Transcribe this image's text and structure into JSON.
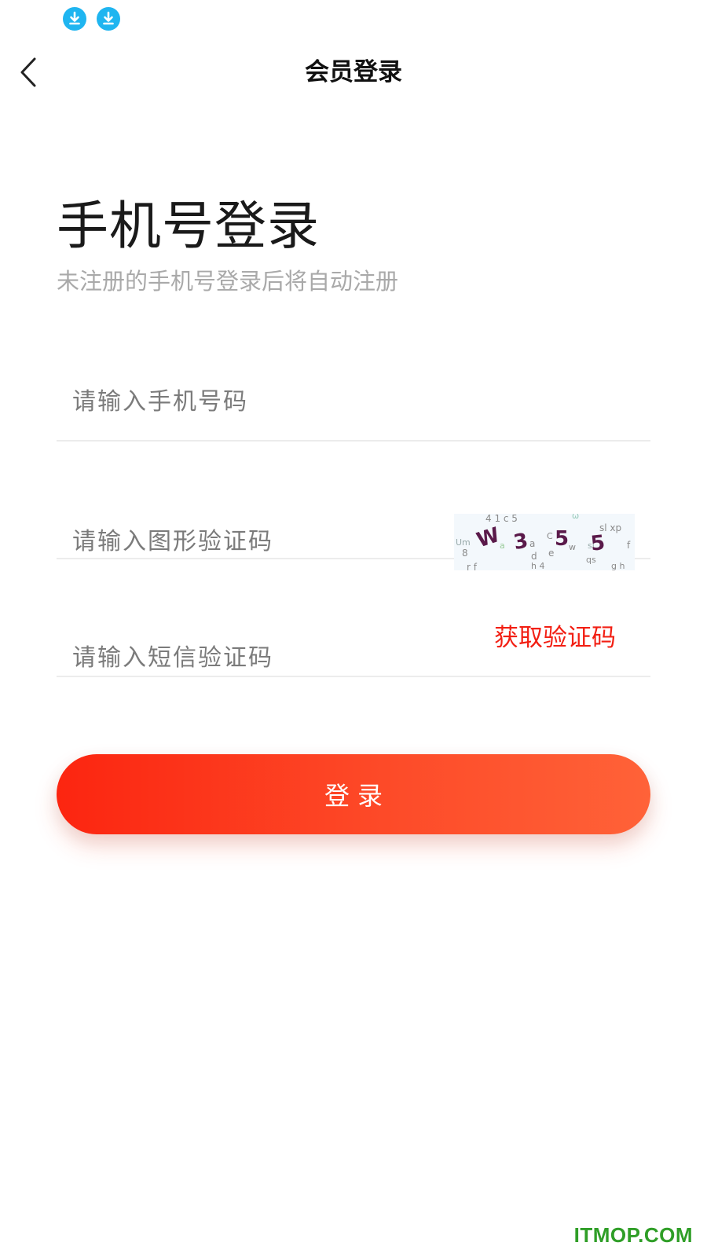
{
  "status_bar": {
    "icons": [
      "download-icon",
      "download-icon"
    ],
    "icon_color": "#1fb5f0"
  },
  "header": {
    "title": "会员登录",
    "back_icon": "chevron-left-icon"
  },
  "main": {
    "title": "手机号登录",
    "subtitle": "未注册的手机号登录后将自动注册"
  },
  "form": {
    "phone": {
      "placeholder": "请输入手机号码",
      "value": ""
    },
    "image_code": {
      "placeholder": "请输入图形验证码",
      "value": "",
      "captcha_text": "W355"
    },
    "sms_code": {
      "placeholder": "请输入短信验证码",
      "value": "",
      "get_code_label": "获取验证码"
    }
  },
  "login_button": {
    "label": "登录"
  },
  "colors": {
    "accent": "#f21f13",
    "button_gradient_start": "#fc2510",
    "button_gradient_end": "#ff6238",
    "divider": "#ececec"
  },
  "watermark": "ITMOP.COM"
}
